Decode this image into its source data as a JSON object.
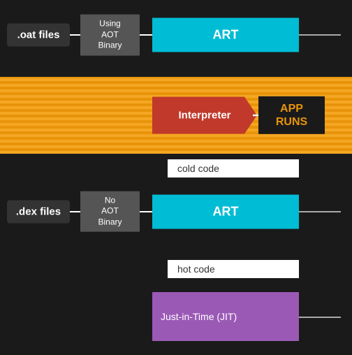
{
  "top": {
    "oat_label": ".oat files",
    "aot_label": "Using\nAOT\nBinary",
    "art_label": "ART"
  },
  "middle": {
    "interpreter_label": "Interpreter",
    "app_runs_label": "APP\nRUNS"
  },
  "cold_code": "cold code",
  "bottom": {
    "dex_label": ".dex files",
    "no_aot_label": "No\nAOT\nBinary",
    "art_label": "ART"
  },
  "hot_code": "hot code",
  "jit": {
    "label": "Just-in-Time (JIT)"
  }
}
